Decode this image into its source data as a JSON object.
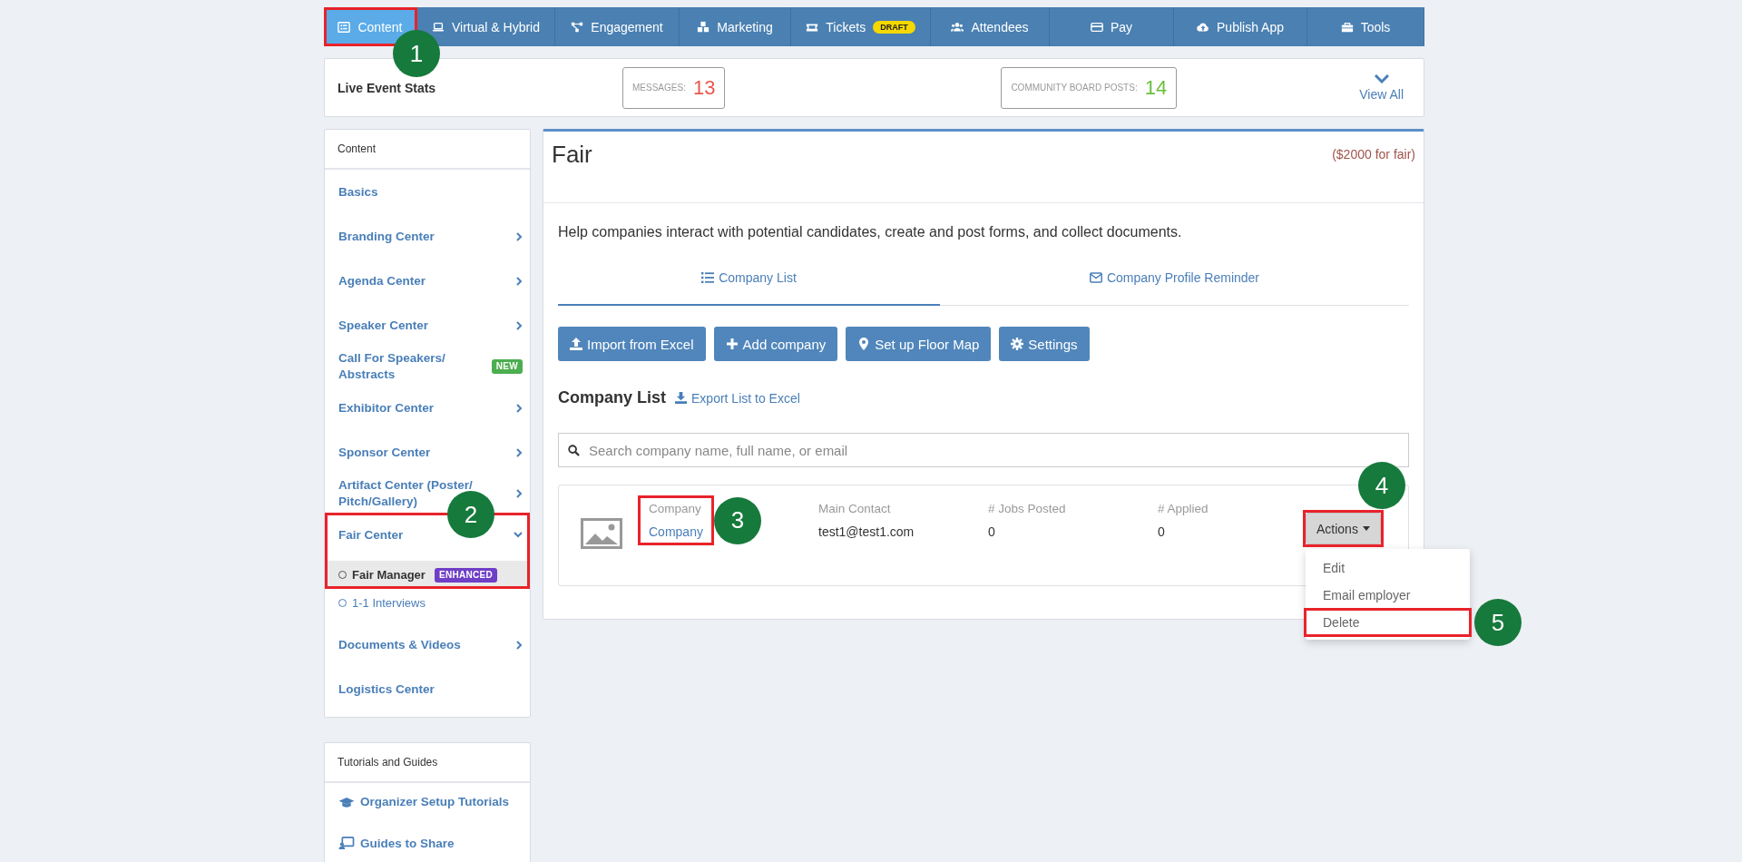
{
  "nav": [
    {
      "label": "Content",
      "selected": true
    },
    {
      "label": "Virtual & Hybrid",
      "selected": false
    },
    {
      "label": "Engagement",
      "selected": false
    },
    {
      "label": "Marketing",
      "selected": false
    },
    {
      "label": "Tickets",
      "selected": false,
      "badge": {
        "text": "DRAFT",
        "color": "#f5d800"
      }
    },
    {
      "label": "Attendees",
      "selected": false
    },
    {
      "label": "Pay",
      "selected": false
    },
    {
      "label": "Publish App",
      "selected": false
    },
    {
      "label": "Tools",
      "selected": false
    }
  ],
  "stats": {
    "title": "Live Event Stats",
    "counters": [
      {
        "label": "MESSAGES:",
        "value": "13",
        "color": "#e8574d"
      },
      {
        "label": "COMMUNITY BOARD POSTS:",
        "value": "14",
        "color": "#6abf3c"
      }
    ],
    "view_all": "View All"
  },
  "sidebar": {
    "sections": [
      {
        "title": "Content",
        "items": [
          {
            "label": "Basics",
            "kind": "link"
          },
          {
            "label": "Branding Center",
            "kind": "group",
            "expanded": false
          },
          {
            "label": "Agenda Center",
            "kind": "group",
            "expanded": false
          },
          {
            "label": "Speaker Center",
            "kind": "group",
            "expanded": false
          },
          {
            "label": "Call For Speakers/ Abstracts",
            "kind": "link",
            "badge": {
              "text": "NEW",
              "color": "#4cae4f"
            }
          },
          {
            "label": "Exhibitor Center",
            "kind": "group",
            "expanded": false
          },
          {
            "label": "Sponsor Center",
            "kind": "group",
            "expanded": false
          },
          {
            "label": "Artifact Center (Poster/ Pitch/Gallery)",
            "kind": "group",
            "expanded": false
          },
          {
            "label": "Fair Center",
            "kind": "group",
            "expanded": true,
            "children": [
              {
                "label": "Fair Manager",
                "selected": true,
                "badge": {
                  "text": "ENHANCED",
                  "color": "#6f3fc6"
                }
              },
              {
                "label": "1-1 Interviews",
                "selected": false
              }
            ]
          },
          {
            "label": "Documents & Videos",
            "kind": "group",
            "expanded": false
          },
          {
            "label": "Logistics Center",
            "kind": "link"
          }
        ]
      },
      {
        "title": "Tutorials and Guides",
        "items": [
          {
            "label": "Organizer Setup Tutorials",
            "kind": "guide"
          },
          {
            "label": "Guides to Share",
            "kind": "guide"
          }
        ]
      }
    ]
  },
  "panel": {
    "title": "Fair",
    "price": "($2000 for fair)",
    "description": "Help companies interact with potential candidates, create and post forms, and collect documents.",
    "tabs": [
      {
        "label": "Company List",
        "selected": true
      },
      {
        "label": "Company Profile Reminder",
        "selected": false
      }
    ],
    "buttons": [
      "Import from Excel",
      "Add company",
      "Set up Floor Map",
      "Settings"
    ],
    "list_title": "Company List",
    "export_link": "Export List to Excel",
    "search": {
      "placeholder": "Search company name, full name, or email"
    },
    "companies": [
      {
        "cells": [
          {
            "label": "Company",
            "value": "Company",
            "kind": "link"
          },
          {
            "label": "Main Contact",
            "value": "test1@test1.com",
            "kind": "text"
          },
          {
            "label": "# Jobs Posted",
            "value": "0",
            "kind": "text"
          },
          {
            "label": "# Applied",
            "value": "0",
            "kind": "text"
          }
        ],
        "actions": {
          "label": "Actions",
          "expanded": true,
          "menu": [
            "Edit",
            "Email employer",
            "Delete"
          ]
        }
      }
    ]
  },
  "callouts": [
    {
      "number": "1"
    },
    {
      "number": "2"
    },
    {
      "number": "3"
    },
    {
      "number": "4"
    },
    {
      "number": "5"
    }
  ]
}
